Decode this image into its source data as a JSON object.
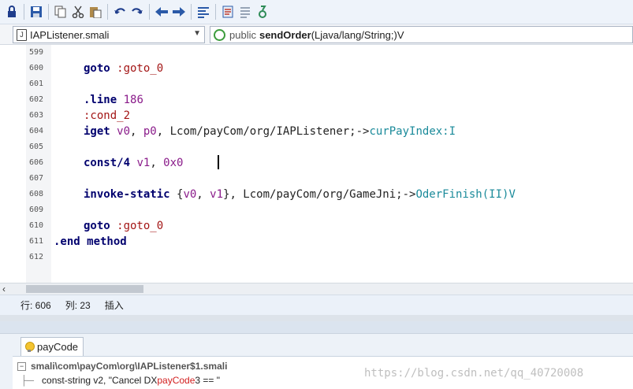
{
  "toolbar": {
    "buttons": [
      "lock-icon",
      "save-icon",
      "copy-icon",
      "cut-icon",
      "paste-icon",
      "undo-icon",
      "redo-icon",
      "nav-back-icon",
      "nav-forward-icon",
      "format-icon",
      "bookmark-icon",
      "align-icon",
      "compile-icon"
    ]
  },
  "navbar": {
    "file_name": "IAPListener.smali",
    "member_modifier": "public",
    "member_name": "sendOrder",
    "member_signature": "(Ljava/lang/String;)V"
  },
  "editor": {
    "lines": [
      {
        "num": "599",
        "tokens": []
      },
      {
        "num": "600",
        "tokens": [
          {
            "t": "goto",
            "c": "kw"
          },
          {
            "t": " :goto_0",
            "c": "label"
          }
        ]
      },
      {
        "num": "601",
        "tokens": []
      },
      {
        "num": "602",
        "tokens": [
          {
            "t": ".line",
            "c": "kw"
          },
          {
            "t": " 186",
            "c": "num"
          }
        ]
      },
      {
        "num": "603",
        "tokens": [
          {
            "t": ":cond_2",
            "c": "label"
          }
        ]
      },
      {
        "num": "604",
        "tokens": [
          {
            "t": "iget",
            "c": "kw"
          },
          {
            "t": " v0",
            "c": "reg"
          },
          {
            "t": ",",
            "c": "plain"
          },
          {
            "t": " p0",
            "c": "reg"
          },
          {
            "t": ", Lcom/payCom/org/IAPListener;->",
            "c": "plain"
          },
          {
            "t": "curPayIndex:I",
            "c": "method"
          }
        ]
      },
      {
        "num": "605",
        "tokens": []
      },
      {
        "num": "606",
        "tokens": [
          {
            "t": "const/4",
            "c": "kw"
          },
          {
            "t": " v1",
            "c": "reg"
          },
          {
            "t": ",",
            "c": "plain"
          },
          {
            "t": " 0x0",
            "c": "num"
          }
        ]
      },
      {
        "num": "607",
        "tokens": []
      },
      {
        "num": "608",
        "tokens": [
          {
            "t": "invoke-static",
            "c": "kw"
          },
          {
            "t": " {",
            "c": "plain"
          },
          {
            "t": "v0",
            "c": "reg"
          },
          {
            "t": ", ",
            "c": "plain"
          },
          {
            "t": "v1",
            "c": "reg"
          },
          {
            "t": "}, Lcom/payCom/org/GameJni;->",
            "c": "plain"
          },
          {
            "t": "OderFinish(II)V",
            "c": "method"
          }
        ]
      },
      {
        "num": "609",
        "tokens": []
      },
      {
        "num": "610",
        "tokens": [
          {
            "t": "goto",
            "c": "kw"
          },
          {
            "t": " :goto_0",
            "c": "label"
          }
        ]
      },
      {
        "num": "611",
        "tokens": [
          {
            "t": ".end method",
            "c": "kw"
          }
        ]
      },
      {
        "num": "612",
        "tokens": []
      }
    ]
  },
  "status": {
    "row": "行: 606",
    "col": "列: 23",
    "mode": "插入"
  },
  "find_panel": {
    "tab_label": "payCode",
    "tree_path": "smali\\com\\payCom\\org\\IAPListener$1.smali",
    "result_prefix": "const-string v2, \"Cancel DX ",
    "result_match": "payCode",
    "result_suffix": "3 == \""
  },
  "watermark": "https://blog.csdn.net/qq_40720008"
}
